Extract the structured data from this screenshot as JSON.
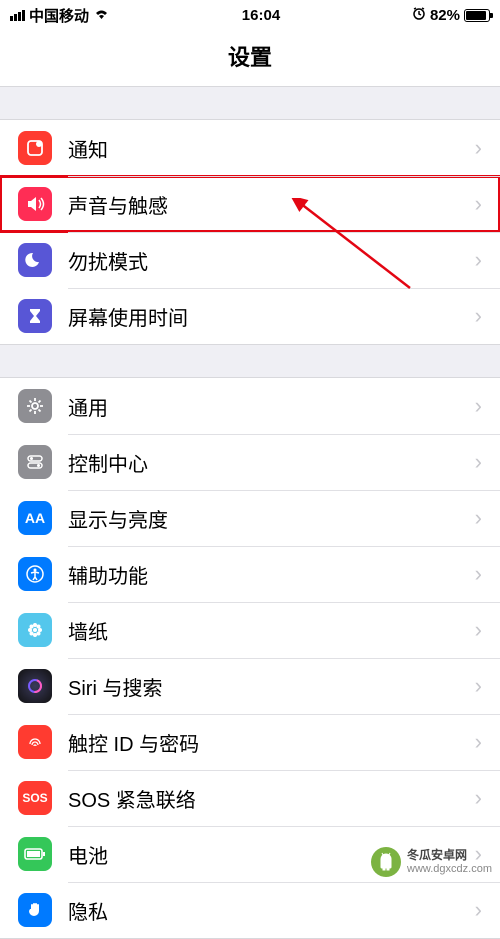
{
  "status": {
    "carrier": "中国移动",
    "time": "16:04",
    "battery_pct": "82%"
  },
  "header": {
    "title": "设置"
  },
  "groups": [
    {
      "rows": [
        {
          "id": "notifications",
          "label": "通知",
          "icon": "notification-icon",
          "color": "#ff3b30",
          "highlight": false
        },
        {
          "id": "sounds",
          "label": "声音与触感",
          "icon": "speaker-icon",
          "color": "#ff3b30",
          "highlight": true
        },
        {
          "id": "dnd",
          "label": "勿扰模式",
          "icon": "moon-icon",
          "color": "#5856d6",
          "highlight": false
        },
        {
          "id": "screentime",
          "label": "屏幕使用时间",
          "icon": "hourglass-icon",
          "color": "#5856d6",
          "highlight": false
        }
      ]
    },
    {
      "rows": [
        {
          "id": "general",
          "label": "通用",
          "icon": "gear-icon",
          "color": "#8e8e93",
          "highlight": false
        },
        {
          "id": "controlcenter",
          "label": "控制中心",
          "icon": "switches-icon",
          "color": "#8e8e93",
          "highlight": false
        },
        {
          "id": "display",
          "label": "显示与亮度",
          "icon": "textsize-icon",
          "color": "#007aff",
          "highlight": false
        },
        {
          "id": "accessibility",
          "label": "辅助功能",
          "icon": "accessibility-icon",
          "color": "#007aff",
          "highlight": false
        },
        {
          "id": "wallpaper",
          "label": "墙纸",
          "icon": "flower-icon",
          "color": "#54c7ec",
          "highlight": false
        },
        {
          "id": "siri",
          "label": "Siri 与搜索",
          "icon": "siri-icon",
          "color": "#222",
          "highlight": false
        },
        {
          "id": "touchid",
          "label": "触控 ID 与密码",
          "icon": "fingerprint-icon",
          "color": "#ff3b30",
          "highlight": false
        },
        {
          "id": "sos",
          "label": "SOS 紧急联络",
          "icon": "sos-icon",
          "color": "#ff3b30",
          "highlight": false
        },
        {
          "id": "battery",
          "label": "电池",
          "icon": "battery-icon",
          "color": "#34c759",
          "highlight": false
        },
        {
          "id": "privacy",
          "label": "隐私",
          "icon": "hand-icon",
          "color": "#007aff",
          "highlight": false
        }
      ]
    }
  ],
  "watermark": {
    "line1": "冬瓜安卓网",
    "line2": "www.dgxcdz.com"
  }
}
